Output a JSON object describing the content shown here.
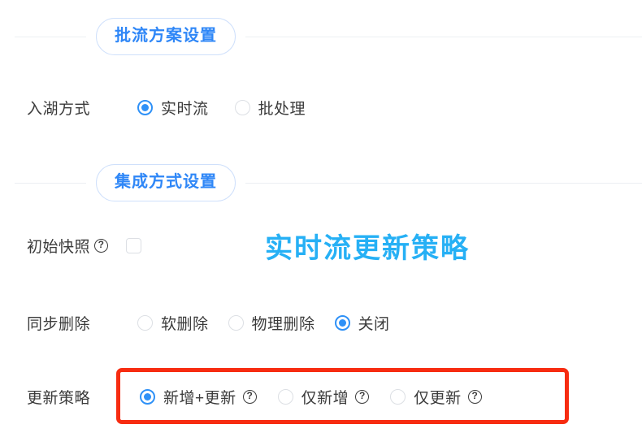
{
  "sections": [
    {
      "title": "批流方案设置",
      "rows": [
        {
          "label": "入湖方式",
          "type": "radio",
          "options": [
            {
              "label": "实时流",
              "selected": true,
              "help": false
            },
            {
              "label": "批处理",
              "selected": false,
              "help": false
            }
          ]
        }
      ]
    },
    {
      "title": "集成方式设置",
      "rows": [
        {
          "label": "初始快照",
          "type": "checkbox",
          "label_help": true,
          "checked": false
        },
        {
          "label": "同步删除",
          "type": "radio",
          "options": [
            {
              "label": "软删除",
              "selected": false,
              "help": false
            },
            {
              "label": "物理删除",
              "selected": false,
              "help": false
            },
            {
              "label": "关闭",
              "selected": true,
              "help": false
            }
          ]
        },
        {
          "label": "更新策略",
          "type": "radio",
          "highlighted": true,
          "options": [
            {
              "label": "新增+更新",
              "selected": true,
              "help": true
            },
            {
              "label": "仅新增",
              "selected": false,
              "help": true
            },
            {
              "label": "仅更新",
              "selected": false,
              "help": true
            }
          ]
        }
      ]
    }
  ],
  "annotation": {
    "text": "实时流更新策略",
    "color": "#26b0f5"
  },
  "icons": {
    "help": "?",
    "help_icon_name": "help-circle-icon"
  },
  "colors": {
    "accent_blue": "#2f91f7",
    "pill_text": "#2f87f7",
    "pill_border": "#cfe0fb",
    "annotation_blue": "#26b0f5",
    "highlight_red": "#f72c11",
    "divider": "#eceff3",
    "label_text": "#3b3b3b",
    "control_border": "#dcdfe4"
  }
}
